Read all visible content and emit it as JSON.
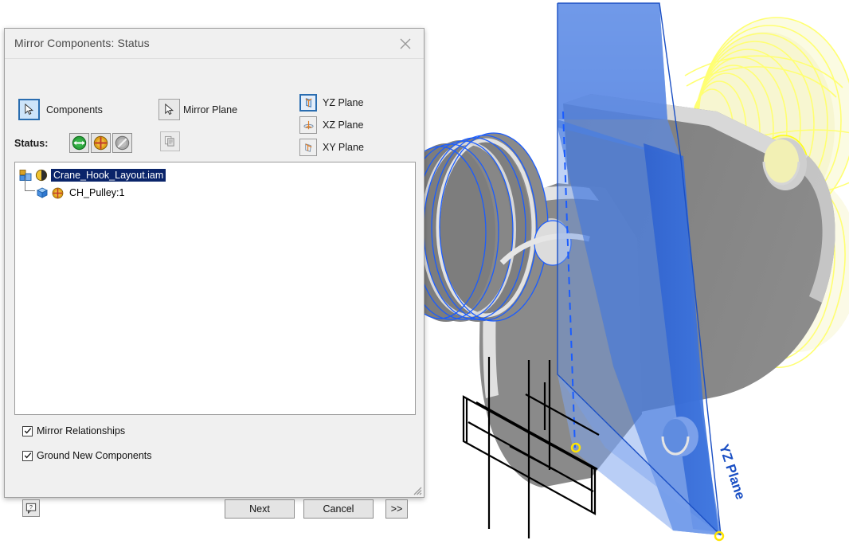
{
  "dialog": {
    "title": "Mirror Components: Status",
    "close_icon": "close-icon",
    "selection": {
      "components": {
        "label": "Components",
        "icon": "cursor-arrow-icon",
        "active": true
      },
      "mirror_plane": {
        "label": "Mirror Plane",
        "icon": "cursor-arrow-icon",
        "active": false
      },
      "copy": {
        "icon": "copy-icon",
        "enabled": false
      }
    },
    "status": {
      "label": "Status:",
      "buttons": [
        {
          "name": "mirror-status-button",
          "icon": "green-mirror-icon",
          "color": "#1e9e33"
        },
        {
          "name": "reuse-status-button",
          "icon": "orange-plus-icon",
          "color": "#e8a317"
        },
        {
          "name": "exclude-status-button",
          "icon": "gray-exclude-icon",
          "color": "#9b9b9b"
        }
      ]
    },
    "planes": [
      {
        "name": "yz-plane-button",
        "label": "YZ Plane",
        "active": true
      },
      {
        "name": "xz-plane-button",
        "label": "XZ Plane",
        "active": false
      },
      {
        "name": "xy-plane-button",
        "label": "XY Plane",
        "active": false
      }
    ],
    "tree": [
      {
        "label": "Crane_Hook_Layout.iam",
        "selected": true,
        "icons": [
          "assembly-icon",
          "half-mirror-icon"
        ],
        "level": 0
      },
      {
        "label": "CH_Pulley:1",
        "selected": false,
        "icons": [
          "part-cube-icon",
          "orange-plus-icon"
        ],
        "level": 1
      }
    ],
    "options": [
      {
        "label": "Mirror Relationships",
        "checked": true
      },
      {
        "label": "Ground New Components",
        "checked": true
      }
    ],
    "footer": {
      "help_label": "?",
      "next_label": "Next",
      "cancel_label": "Cancel",
      "expand_label": ">>"
    }
  },
  "viewport": {
    "plane_label": "YZ Plane",
    "colors": {
      "plane_fill": "#3f74d8",
      "plane_edge": "#1a4fc4",
      "body_gray": "#808080",
      "body_light": "#d9d9d9",
      "highlight_blue": "#1a5cff",
      "preview_yellow": "#ffff00",
      "marker_yellow": "#ffe400"
    }
  }
}
